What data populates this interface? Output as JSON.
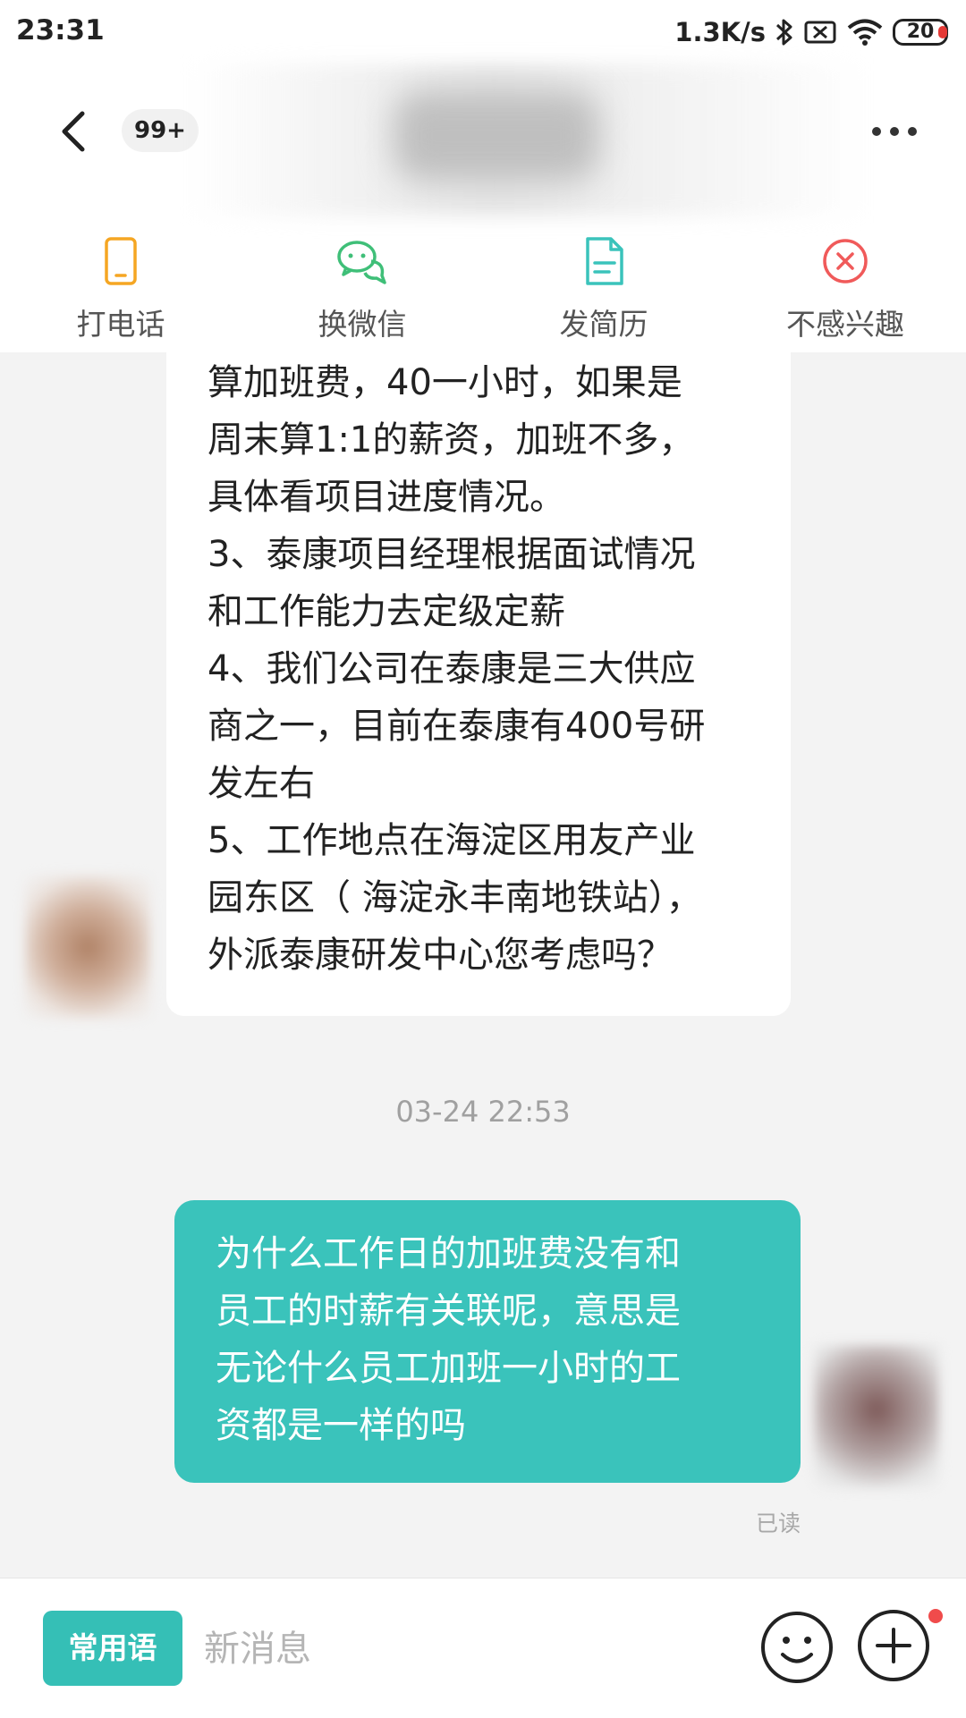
{
  "status_bar": {
    "time": "23:31",
    "net_speed": "1.3K/s",
    "battery": "20",
    "icons": [
      "bluetooth-icon",
      "sim-icon",
      "wifi-icon",
      "battery-icon"
    ]
  },
  "header": {
    "badge": "99+",
    "actions": [
      {
        "label": "打电话",
        "icon": "phone-icon",
        "color": "#f5a623"
      },
      {
        "label": "换微信",
        "icon": "wechat-icon",
        "color": "#3fbf78"
      },
      {
        "label": "发简历",
        "icon": "resume-icon",
        "color": "#3ac3bb"
      },
      {
        "label": "不感兴趣",
        "icon": "not-interested-icon",
        "color": "#f05a5a"
      }
    ]
  },
  "chat": {
    "incoming": {
      "lines": [
        "算加班费，40一小时，如果是",
        "周末算1:1的薪资，加班不多，",
        "具体看项目进度情况。",
        "3、泰康项目经理根据面试情况",
        "和工作能力去定级定薪",
        "4、我们公司在泰康是三大供应",
        "商之一，目前在泰康有400号研",
        "发左右",
        "5、工作地点在海淀区用友产业",
        "园东区（ 海淀永丰南地铁站），",
        "外派泰康研发中心您考虑吗？"
      ]
    },
    "timestamp": "03-24 22:53",
    "outgoing": {
      "lines": [
        "为什么工作日的加班费没有和",
        "员工的时薪有关联呢，意思是",
        "无论什么员工加班一小时的工",
        "资都是一样的吗"
      ],
      "color": "#3ac3bb"
    },
    "read_status": "已读"
  },
  "input_bar": {
    "quick_phrases": "常用语",
    "placeholder": "新消息"
  },
  "colors": {
    "accent": "#35bfb6",
    "background": "#f3f3f3",
    "notification_dot": "#f04b4b"
  }
}
